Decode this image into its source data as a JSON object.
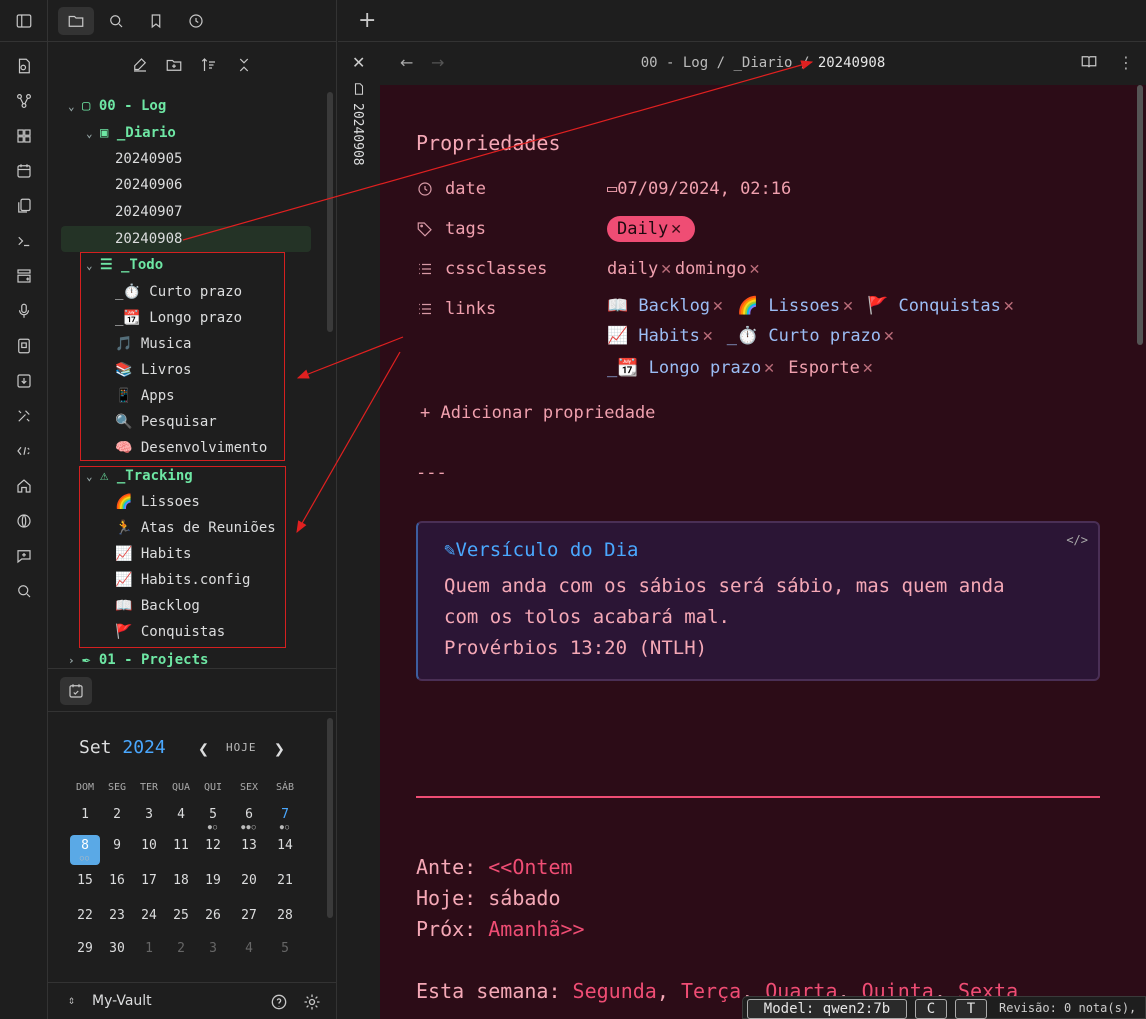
{
  "tree": {
    "log_folder": "00 - Log",
    "diario_folder": "_Diario",
    "diario_files": [
      "20240905",
      "20240906",
      "20240907",
      "20240908"
    ],
    "todo_folder": "_Todo",
    "todo_files": [
      "_⏱️ Curto prazo",
      "_📆 Longo prazo",
      "🎵 Musica",
      "📚 Livros",
      "📱 Apps",
      "🔍 Pesquisar",
      "🧠 Desenvolvimento"
    ],
    "tracking_folder": "_Tracking",
    "tracking_files": [
      "🌈 Lissoes",
      "🏃 Atas de Reuniões",
      "📈 Habits",
      "📈 Habits.config",
      "📖 Backlog",
      "🚩 Conquistas"
    ],
    "projects_folder": "01 - Projects"
  },
  "calendar": {
    "month": "Set",
    "year": "2024",
    "today_label": "HOJE",
    "weekdays": [
      "DOM",
      "SEG",
      "TER",
      "QUA",
      "QUI",
      "SEX",
      "SÁB"
    ],
    "weeks": [
      [
        "1",
        "2",
        "3",
        "4",
        "5",
        "6",
        "7"
      ],
      [
        "8",
        "9",
        "10",
        "11",
        "12",
        "13",
        "14"
      ],
      [
        "15",
        "16",
        "17",
        "18",
        "19",
        "20",
        "21"
      ],
      [
        "22",
        "23",
        "24",
        "25",
        "26",
        "27",
        "28"
      ],
      [
        "29",
        "30",
        "1",
        "2",
        "3",
        "4",
        "5"
      ]
    ]
  },
  "vault": {
    "name": "My-Vault"
  },
  "breadcrumb": {
    "part1": "00 - Log",
    "sep": "/",
    "part2": "_Diario",
    "current": "20240908"
  },
  "tab": {
    "title": "20240908"
  },
  "properties": {
    "title": "Propriedades",
    "date_key": "date",
    "date_value": "07/09/2024, 02:16",
    "tags_key": "tags",
    "tag": "Daily",
    "cssclasses_key": "cssclasses",
    "cssclasses": [
      "daily",
      "domingo"
    ],
    "links_key": "links",
    "links": [
      "📖 Backlog",
      "🌈 Lissoes",
      "🚩 Conquistas",
      "📈 Habits",
      "_⏱️ Curto prazo",
      "_📆 Longo prazo",
      "Esporte"
    ],
    "add_label": "Adicionar propriedade"
  },
  "hr_text": "---",
  "callout": {
    "title": "Versículo do Dia",
    "line1": "Quem anda com os sábios será sábio, mas quem anda",
    "line2": "com os tolos acabará mal.",
    "line3": "Provérbios 13:20 (NTLH)"
  },
  "nav": {
    "ante_label": "Ante:",
    "ante_link": "<<Ontem",
    "hoje_label": "Hoje:",
    "hoje_value": "sábado",
    "prox_label": "Próx:",
    "prox_link": "Amanhã>>",
    "week_label": "Esta semana:",
    "week_days": [
      "Segunda",
      "Terça",
      "Quarta",
      "Quinta",
      "Sexta"
    ]
  },
  "status": {
    "model": "Model: qwen2:7b",
    "c": "C",
    "t": "T",
    "revision": "Revisão: 0 nota(s),"
  },
  "colors": {
    "folder": "#6ee7a4",
    "accent": "#ef4d74",
    "link": "#9bbdf5",
    "content_bg": "#2c0c17",
    "annotation": "#d42020"
  }
}
